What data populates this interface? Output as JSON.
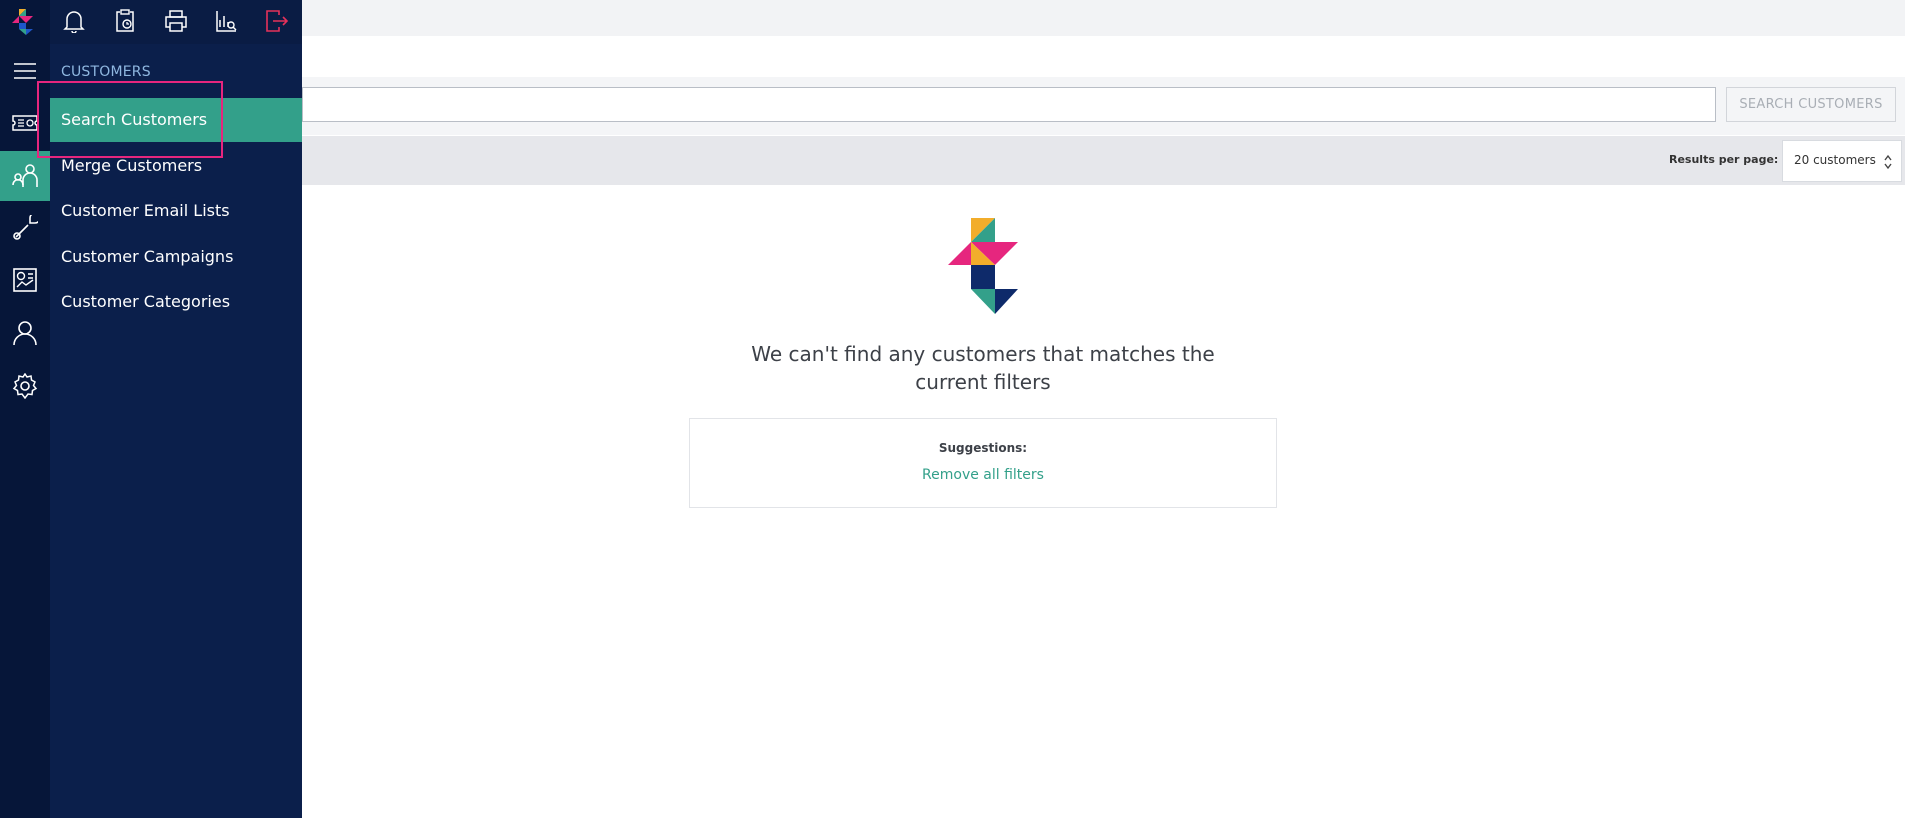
{
  "flyout": {
    "section_title": "CUSTOMERS",
    "items": [
      {
        "label": "Search Customers",
        "active": true
      },
      {
        "label": "Merge Customers",
        "active": false
      },
      {
        "label": "Customer Email Lists",
        "active": false
      },
      {
        "label": "Customer Campaigns",
        "active": false
      },
      {
        "label": "Customer Categories",
        "active": false
      }
    ],
    "top_icons": [
      "bell-icon",
      "clipboard-clock-icon",
      "printer-icon",
      "chart-report-icon",
      "logout-icon"
    ]
  },
  "rail": {
    "icons": [
      "brand-logo-icon",
      "hamburger-menu-icon",
      "ticket-icon",
      "customers-icon",
      "wrench-icon",
      "report-icon",
      "user-icon",
      "gear-icon"
    ],
    "active": "customers-icon"
  },
  "search": {
    "placeholder": "",
    "value": "",
    "button_label": "SEARCH CUSTOMERS"
  },
  "results": {
    "per_page_label": "Results per page:",
    "per_page_value": "20 customers"
  },
  "empty_state": {
    "message": "We can't find any customers that matches the current filters",
    "suggestions_title": "Suggestions:",
    "suggestion_link": "Remove all filters"
  },
  "colors": {
    "rail_bg": "#061639",
    "flyout_bg": "#0b1f4b",
    "accent_green": "#33a08a",
    "highlight_pink": "#e6267e",
    "logout_red": "#e5315a"
  }
}
